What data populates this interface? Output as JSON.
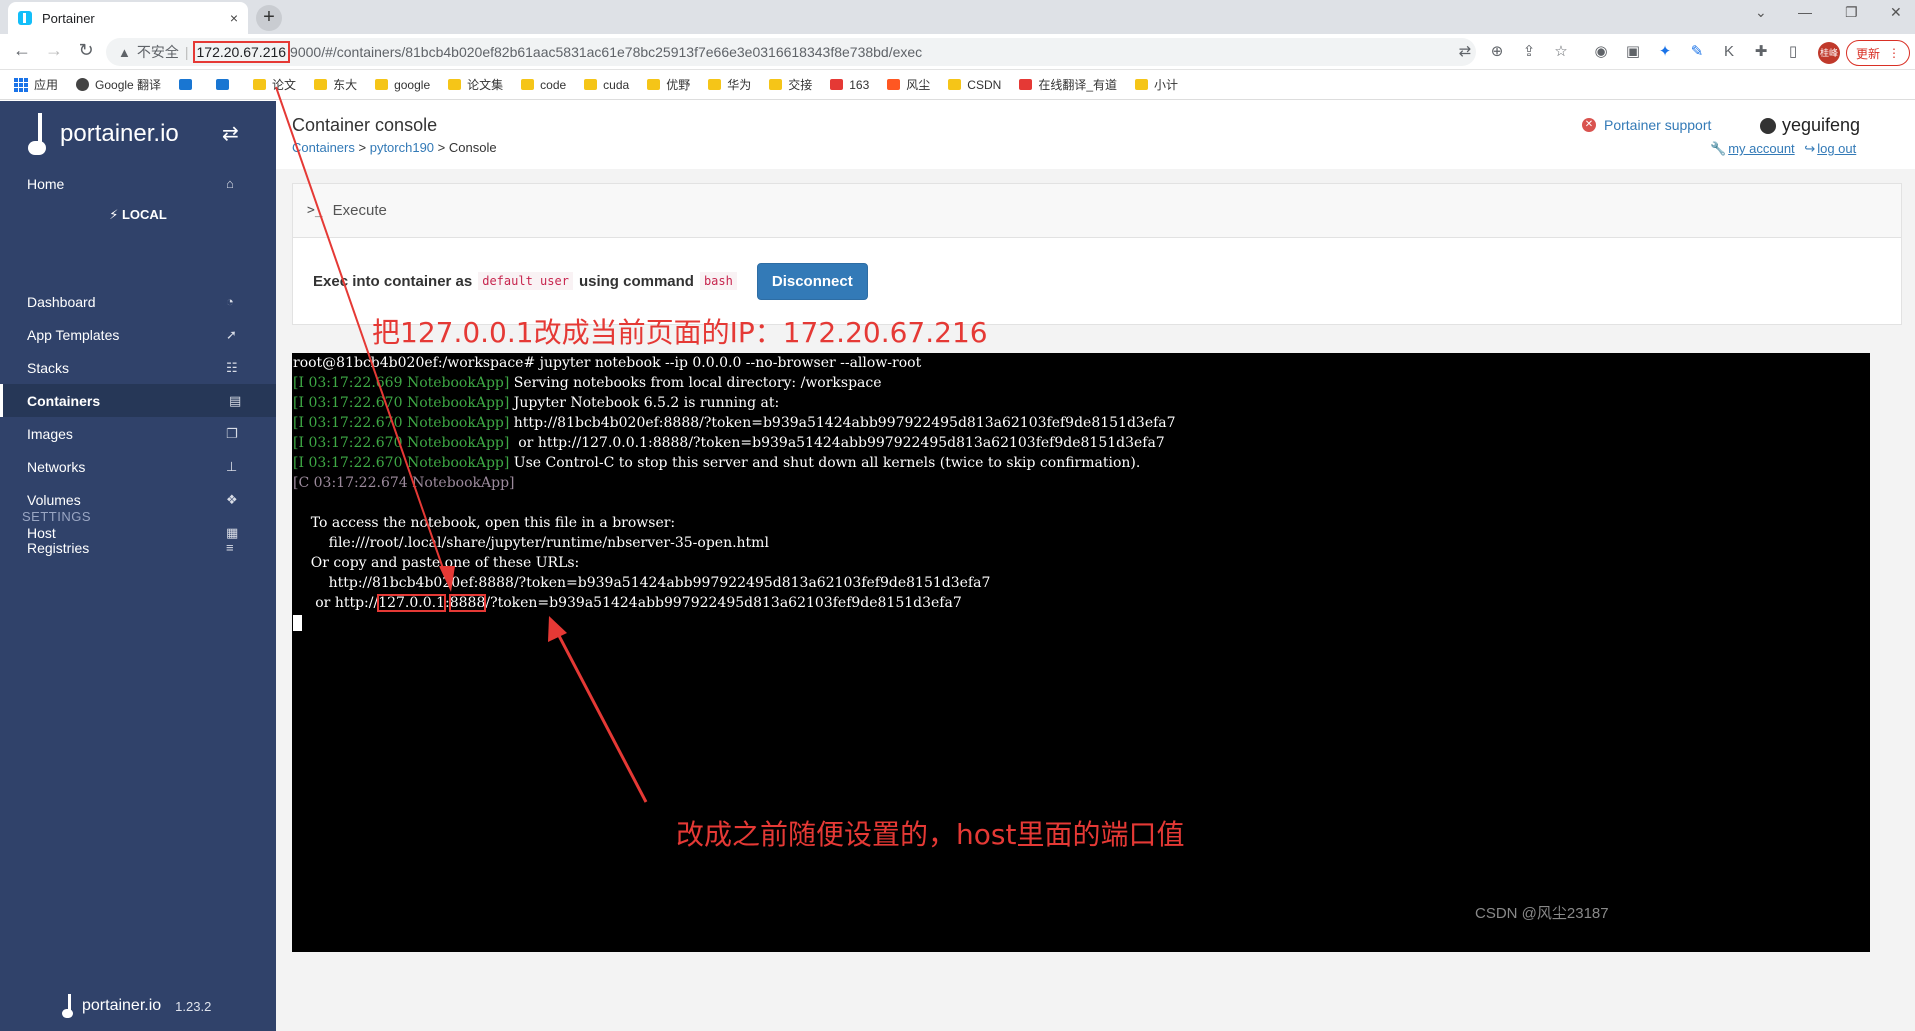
{
  "browser": {
    "tab_title": "Portainer",
    "tab_close": "×",
    "new_tab": "+",
    "insecure_label": "不安全",
    "url_host": "172.20.67.216",
    "url_path": "9000/#/containers/81bcb4b020ef82b61aac5831ac61e78bc25913f7e66e3e0316618343f8e738bd/exec",
    "profile_label": "桂峰",
    "update_label": "更新",
    "bookmarks": [
      {
        "label": "应用",
        "icon": "apps-icon"
      },
      {
        "label": "Google 翻译",
        "icon": "globe-icon"
      },
      {
        "label": "",
        "icon": "bilibili-icon"
      },
      {
        "label": "",
        "icon": "baidu-icon"
      },
      {
        "label": "论文",
        "icon": "folder-icon"
      },
      {
        "label": "东大",
        "icon": "folder-icon"
      },
      {
        "label": "google",
        "icon": "folder-icon"
      },
      {
        "label": "论文集",
        "icon": "folder-icon"
      },
      {
        "label": "code",
        "icon": "folder-icon"
      },
      {
        "label": "cuda",
        "icon": "folder-icon"
      },
      {
        "label": "优野",
        "icon": "folder-icon"
      },
      {
        "label": "华为",
        "icon": "folder-icon"
      },
      {
        "label": "交接",
        "icon": "folder-icon"
      },
      {
        "label": "163",
        "icon": "netease-icon"
      },
      {
        "label": "风尘",
        "icon": "csdn-icon"
      },
      {
        "label": "CSDN",
        "icon": "folder-icon"
      },
      {
        "label": "在线翻译_有道",
        "icon": "youdao-icon"
      },
      {
        "label": "小计",
        "icon": "folder-icon"
      }
    ]
  },
  "sidebar": {
    "logo_text": "portainer.io",
    "home": "Home",
    "endpoint": "LOCAL",
    "items": [
      {
        "label": "Dashboard",
        "icon": "dashboard-icon"
      },
      {
        "label": "App Templates",
        "icon": "rocket-icon"
      },
      {
        "label": "Stacks",
        "icon": "th-list-icon"
      },
      {
        "label": "Containers",
        "icon": "server-icon",
        "active": true
      },
      {
        "label": "Images",
        "icon": "clone-icon"
      },
      {
        "label": "Networks",
        "icon": "sitemap-icon"
      },
      {
        "label": "Volumes",
        "icon": "cubes-icon"
      },
      {
        "label": "Host",
        "icon": "th-icon"
      }
    ],
    "settings_heading": "SETTINGS",
    "registries": "Registries",
    "footer_logo": "portainer.io",
    "version": "1.23.2"
  },
  "header": {
    "title": "Container console",
    "breadcrumb": {
      "containers": "Containers",
      "container": "pytorch190",
      "current": "Console",
      "sep": ">"
    },
    "support": "Portainer support",
    "username": "yeguifeng",
    "my_account": "my account",
    "log_out": "log out"
  },
  "exec_panel": {
    "heading": "Execute",
    "prefix": "Exec into container as",
    "user": "default user",
    "middle": "using command",
    "command": "bash",
    "disconnect": "Disconnect"
  },
  "annotations": {
    "top": "把127.0.0.1改成当前页面的IP：172.20.67.216",
    "bottom": "改成之前随便设置的，host里面的端口值"
  },
  "terminal": {
    "prompt": "root@81bcb4b020ef:/workspace# jupyter notebook --ip 0.0.0.0 --no-browser --allow-root",
    "log_lines": [
      {
        "tag": "[I 03:17:22.669 NotebookApp]",
        "msg": " Serving notebooks from local directory: /workspace"
      },
      {
        "tag": "[I 03:17:22.670 NotebookApp]",
        "msg": " Jupyter Notebook 6.5.2 is running at:"
      },
      {
        "tag": "[I 03:17:22.670 NotebookApp]",
        "msg": " http://81bcb4b020ef:8888/?token=b939a51424abb997922495d813a62103fef9de8151d3efa7"
      },
      {
        "tag": "[I 03:17:22.670 NotebookApp]",
        "msg": "  or http://127.0.0.1:8888/?token=b939a51424abb997922495d813a62103fef9de8151d3efa7"
      },
      {
        "tag": "[I 03:17:22.670 NotebookApp]",
        "msg": " Use Control-C to stop this server and shut down all kernels (twice to skip confirmation)."
      }
    ],
    "critical_tag": "[C 03:17:22.674 NotebookApp]",
    "access_line": "    To access the notebook, open this file in a browser:",
    "file_line": "        file:///root/.local/share/jupyter/runtime/nbserver-35-open.html",
    "copy_line": "    Or copy and paste one of these URLs:",
    "url_line": "        http://81bcb4b020ef:8888/?token=b939a51424abb997922495d813a62103fef9de8151d3efa7",
    "or_prefix": "     or http://",
    "or_ip": "127.0.0.1",
    "or_colon": ":",
    "or_port": "8888",
    "or_rest": "/?token=b939a51424abb997922495d813a62103fef9de8151d3efa7"
  },
  "watermark": "CSDN @风尘23187",
  "colors": {
    "sidebar": "#30426a",
    "accent": "#337ab7",
    "annotation": "#e53935",
    "terminal_green": "#3ea845"
  }
}
